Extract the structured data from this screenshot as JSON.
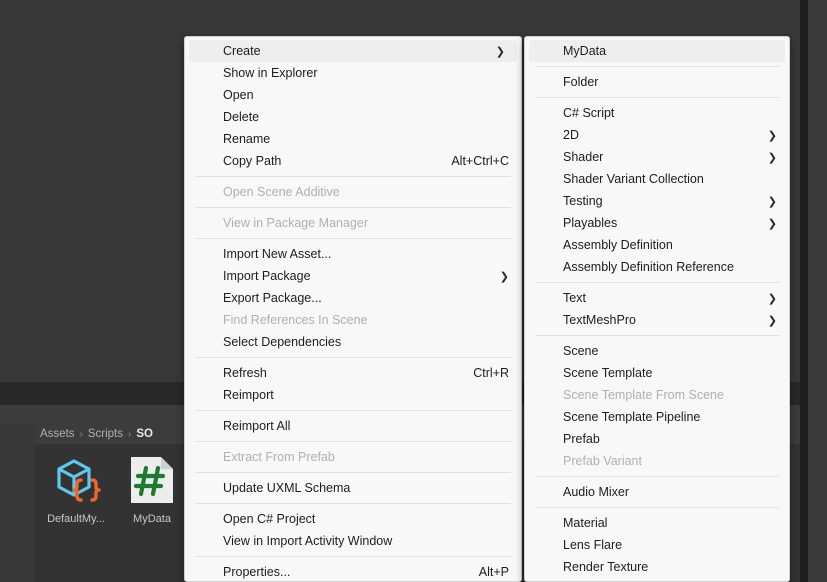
{
  "editor": {
    "breadcrumb": {
      "separator": "›",
      "items": [
        {
          "label": "Assets",
          "current": false
        },
        {
          "label": "Scripts",
          "current": false
        },
        {
          "label": "SO",
          "current": true
        }
      ]
    },
    "assets": [
      {
        "label": "DefaultMy...",
        "icon": "scriptable-object-icon"
      },
      {
        "label": "MyData",
        "icon": "csharp-script-icon"
      }
    ],
    "colors": {
      "background": "#383838",
      "panel": "#333333",
      "toolbar": "#3c3c3c",
      "icon_cube_blue": "#5ec8f0",
      "icon_braces_orange": "#f2662a",
      "icon_hash_green": "#1e7a2e"
    }
  },
  "context_menu": {
    "name": "asset-context-menu",
    "items": [
      {
        "label": "Create",
        "shortcut": "",
        "submenu": true,
        "disabled": false,
        "highlight": true
      },
      {
        "label": "Show in Explorer",
        "shortcut": "",
        "submenu": false,
        "disabled": false
      },
      {
        "label": "Open",
        "shortcut": "",
        "submenu": false,
        "disabled": false
      },
      {
        "label": "Delete",
        "shortcut": "",
        "submenu": false,
        "disabled": false
      },
      {
        "label": "Rename",
        "shortcut": "",
        "submenu": false,
        "disabled": false
      },
      {
        "label": "Copy Path",
        "shortcut": "Alt+Ctrl+C",
        "submenu": false,
        "disabled": false
      },
      {
        "separator": true
      },
      {
        "label": "Open Scene Additive",
        "shortcut": "",
        "submenu": false,
        "disabled": true
      },
      {
        "separator": true
      },
      {
        "label": "View in Package Manager",
        "shortcut": "",
        "submenu": false,
        "disabled": true
      },
      {
        "separator": true
      },
      {
        "label": "Import New Asset...",
        "shortcut": "",
        "submenu": false,
        "disabled": false
      },
      {
        "label": "Import Package",
        "shortcut": "",
        "submenu": true,
        "disabled": false
      },
      {
        "label": "Export Package...",
        "shortcut": "",
        "submenu": false,
        "disabled": false
      },
      {
        "label": "Find References In Scene",
        "shortcut": "",
        "submenu": false,
        "disabled": true
      },
      {
        "label": "Select Dependencies",
        "shortcut": "",
        "submenu": false,
        "disabled": false
      },
      {
        "separator": true
      },
      {
        "label": "Refresh",
        "shortcut": "Ctrl+R",
        "submenu": false,
        "disabled": false
      },
      {
        "label": "Reimport",
        "shortcut": "",
        "submenu": false,
        "disabled": false
      },
      {
        "separator": true
      },
      {
        "label": "Reimport All",
        "shortcut": "",
        "submenu": false,
        "disabled": false
      },
      {
        "separator": true
      },
      {
        "label": "Extract From Prefab",
        "shortcut": "",
        "submenu": false,
        "disabled": true
      },
      {
        "separator": true
      },
      {
        "label": "Update UXML Schema",
        "shortcut": "",
        "submenu": false,
        "disabled": false
      },
      {
        "separator": true
      },
      {
        "label": "Open C# Project",
        "shortcut": "",
        "submenu": false,
        "disabled": false
      },
      {
        "label": "View in Import Activity Window",
        "shortcut": "",
        "submenu": false,
        "disabled": false
      },
      {
        "separator": true
      },
      {
        "label": "Properties...",
        "shortcut": "Alt+P",
        "submenu": false,
        "disabled": false
      }
    ]
  },
  "create_submenu": {
    "name": "create-submenu",
    "items": [
      {
        "label": "MyData",
        "shortcut": "",
        "submenu": false,
        "disabled": false,
        "highlight": true
      },
      {
        "separator": true
      },
      {
        "label": "Folder",
        "shortcut": "",
        "submenu": false,
        "disabled": false
      },
      {
        "separator": true
      },
      {
        "label": "C# Script",
        "shortcut": "",
        "submenu": false,
        "disabled": false
      },
      {
        "label": "2D",
        "shortcut": "",
        "submenu": true,
        "disabled": false
      },
      {
        "label": "Shader",
        "shortcut": "",
        "submenu": true,
        "disabled": false
      },
      {
        "label": "Shader Variant Collection",
        "shortcut": "",
        "submenu": false,
        "disabled": false
      },
      {
        "label": "Testing",
        "shortcut": "",
        "submenu": true,
        "disabled": false
      },
      {
        "label": "Playables",
        "shortcut": "",
        "submenu": true,
        "disabled": false
      },
      {
        "label": "Assembly Definition",
        "shortcut": "",
        "submenu": false,
        "disabled": false
      },
      {
        "label": "Assembly Definition Reference",
        "shortcut": "",
        "submenu": false,
        "disabled": false
      },
      {
        "separator": true
      },
      {
        "label": "Text",
        "shortcut": "",
        "submenu": true,
        "disabled": false
      },
      {
        "label": "TextMeshPro",
        "shortcut": "",
        "submenu": true,
        "disabled": false
      },
      {
        "separator": true
      },
      {
        "label": "Scene",
        "shortcut": "",
        "submenu": false,
        "disabled": false
      },
      {
        "label": "Scene Template",
        "shortcut": "",
        "submenu": false,
        "disabled": false
      },
      {
        "label": "Scene Template From Scene",
        "shortcut": "",
        "submenu": false,
        "disabled": true
      },
      {
        "label": "Scene Template Pipeline",
        "shortcut": "",
        "submenu": false,
        "disabled": false
      },
      {
        "label": "Prefab",
        "shortcut": "",
        "submenu": false,
        "disabled": false
      },
      {
        "label": "Prefab Variant",
        "shortcut": "",
        "submenu": false,
        "disabled": true
      },
      {
        "separator": true
      },
      {
        "label": "Audio Mixer",
        "shortcut": "",
        "submenu": false,
        "disabled": false
      },
      {
        "separator": true
      },
      {
        "label": "Material",
        "shortcut": "",
        "submenu": false,
        "disabled": false
      },
      {
        "label": "Lens Flare",
        "shortcut": "",
        "submenu": false,
        "disabled": false
      },
      {
        "label": "Render Texture",
        "shortcut": "",
        "submenu": false,
        "disabled": false
      }
    ]
  },
  "glyphs": {
    "submenu_arrow": "❯"
  }
}
